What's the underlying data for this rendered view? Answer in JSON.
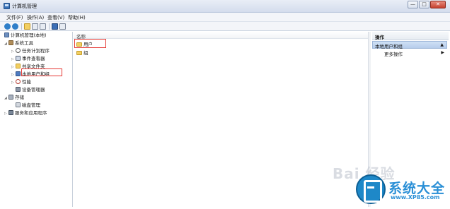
{
  "window": {
    "title": "计算机管理",
    "minimize": "—",
    "maximize": "□",
    "close": "✕"
  },
  "menubar": [
    "文件(F)",
    "操作(A)",
    "查看(V)",
    "帮助(H)"
  ],
  "toolbar": {
    "icons": [
      "back-icon",
      "forward-icon",
      "folder-up-icon",
      "show-hide-tree-icon",
      "properties-icon",
      "help-icon",
      "console-icon"
    ]
  },
  "tree": {
    "root": "计算机管理(本地)",
    "items": [
      {
        "label": "系统工具",
        "arrow": "◢"
      },
      {
        "label": "任务计划程序",
        "arrow": "▷"
      },
      {
        "label": "事件查看器",
        "arrow": "▷"
      },
      {
        "label": "共享文件夹",
        "arrow": "▷"
      },
      {
        "label": "本地用户和组",
        "arrow": "▷"
      },
      {
        "label": "性能",
        "arrow": "▷"
      },
      {
        "label": "设备管理器",
        "arrow": ""
      },
      {
        "label": "存储",
        "arrow": "◢"
      },
      {
        "label": "磁盘管理",
        "arrow": ""
      },
      {
        "label": "服务和应用程序",
        "arrow": "▷"
      }
    ]
  },
  "content": {
    "column_header": "名称",
    "rows": [
      "用户",
      "组"
    ]
  },
  "actions": {
    "header": "操作",
    "group": "本地用户和组",
    "group_caret": "▲",
    "item": "更多操作",
    "item_caret": "▶"
  },
  "watermark": {
    "baidu": "Bai 经验",
    "brand": "系统大全",
    "url": "www.XP85.com"
  },
  "colors": {
    "highlight": "#e53935",
    "action_group": "#cfe0f5",
    "brand": "#2a8fd6"
  }
}
